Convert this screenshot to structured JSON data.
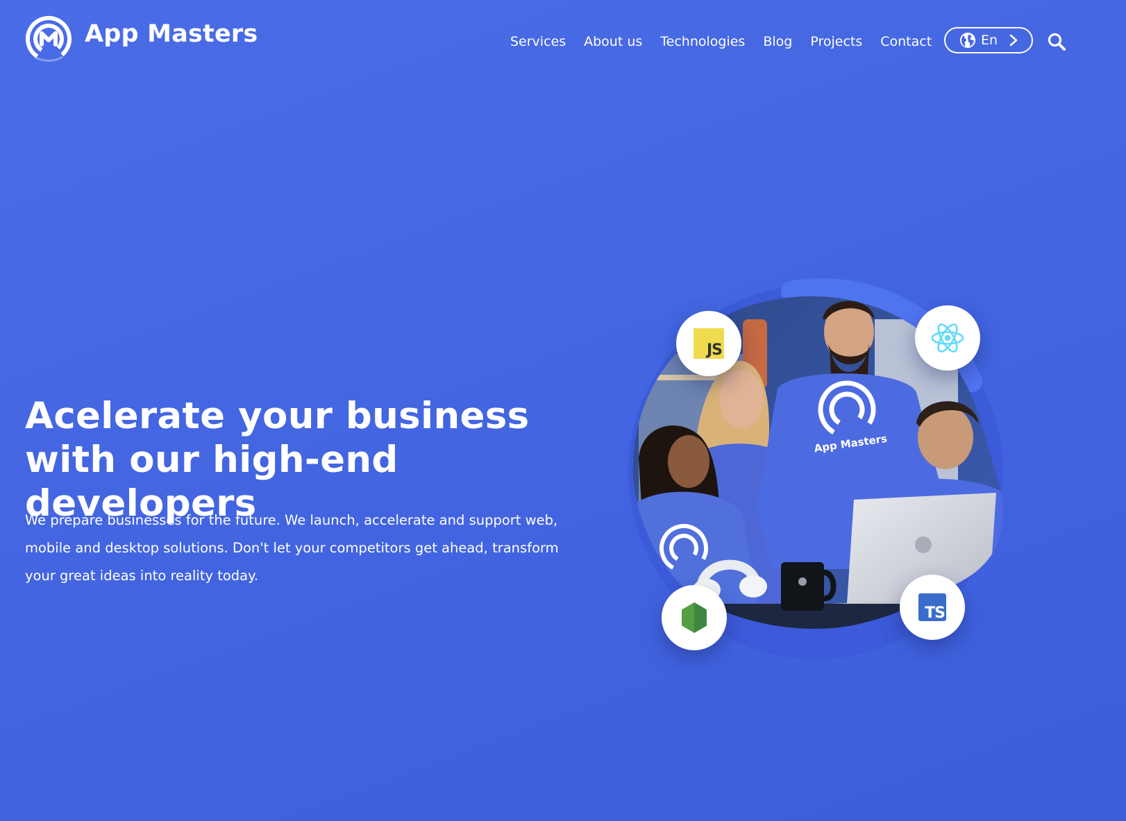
{
  "brand": {
    "name": "App Masters",
    "logo_icon": "app-masters-logo-icon",
    "primary_color": "#4466e2",
    "accent_color": "#ffffff"
  },
  "nav": {
    "items": [
      {
        "label": "Services"
      },
      {
        "label": "About us"
      },
      {
        "label": "Technologies"
      },
      {
        "label": "Blog"
      },
      {
        "label": "Projects"
      },
      {
        "label": "Contact"
      }
    ],
    "language": {
      "label": "En",
      "icon": "globe-icon",
      "arrow_icon": "chevron-right-icon"
    },
    "search_icon": "search-icon"
  },
  "hero": {
    "title": "Acelerate your business with our high-end developers",
    "description": "We prepare businesses for the future. We launch, accelerate and support web, mobile and desktop solutions. Don't let your competitors get ahead, transform your great ideas into reality today.",
    "image": {
      "subject": "team-photo",
      "shirt_text": "App Masters",
      "tech_badges": [
        {
          "name": "javascript-icon",
          "label": "JS"
        },
        {
          "name": "react-icon"
        },
        {
          "name": "nodejs-icon"
        },
        {
          "name": "typescript-icon",
          "label": "TS"
        }
      ]
    }
  }
}
